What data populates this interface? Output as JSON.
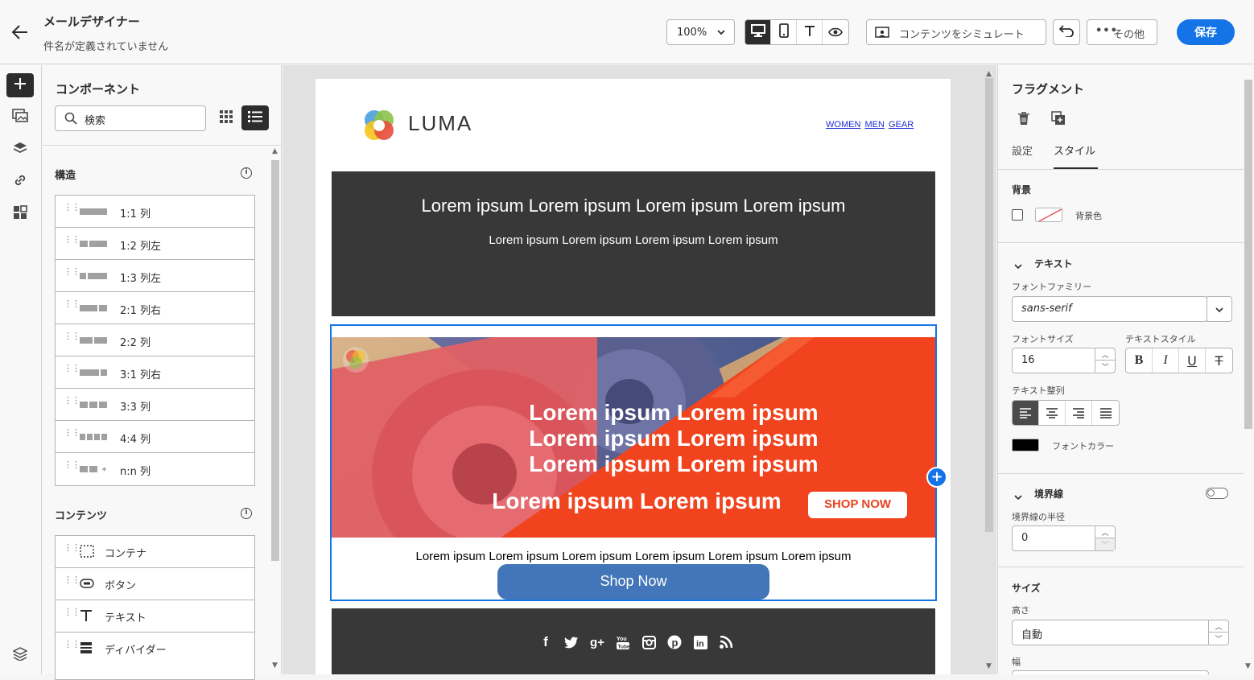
{
  "header": {
    "title": "メールデザイナー",
    "subtitle": "件名が定義されていません",
    "zoom": "100%",
    "simulate_label": "コンテンツをシミュレート",
    "more_label": "その他",
    "save_label": "保存"
  },
  "left_panel": {
    "title": "コンポーネント",
    "search_placeholder": "検索",
    "structure_title": "構造",
    "structure_items": [
      "1:1 列",
      "1:2 列左",
      "1:3 列左",
      "2:1 列右",
      "2:2 列",
      "3:1 列右",
      "3:3 列",
      "4:4 列",
      "n:n 列"
    ],
    "content_title": "コンテンツ",
    "content_items": [
      "コンテナ",
      "ボタン",
      "テキスト",
      "ディバイダー"
    ]
  },
  "email": {
    "brand": "LUMA",
    "nav": [
      "WOMEN",
      "MEN",
      "GEAR"
    ],
    "banner_heading": "Lorem ipsum Lorem ipsum  Lorem ipsum  Lorem ipsum",
    "banner_sub": "Lorem ipsum Lorem ipsum  Lorem ipsum  Lorem ipsum",
    "hero_lines": [
      "Lorem ipsum Lorem ipsum",
      "Lorem ipsum Lorem ipsum",
      "Lorem ipsum Lorem ipsum",
      "Lorem ipsum Lorem ipsum"
    ],
    "hero_button": "SHOP NOW",
    "body_text": "Lorem ipsum Lorem ipsum Lorem ipsum Lorem ipsum Lorem ipsum Lorem ipsum",
    "cta": "Shop Now",
    "social_icons": [
      "facebook-icon",
      "twitter-icon",
      "googleplus-icon",
      "youtube-icon",
      "instagram-icon",
      "pinterest-icon",
      "linkedin-icon",
      "rss-icon"
    ]
  },
  "right_panel": {
    "title": "フラグメント",
    "tab_settings": "設定",
    "tab_style": "スタイル",
    "bg_section": "背景",
    "bg_color_label": "背景色",
    "text_section": "テキスト",
    "font_family_label": "フォントファミリー",
    "font_family_value": "sans-serif",
    "font_size_label": "フォントサイズ",
    "font_size_value": "16",
    "text_style_label": "テキストスタイル",
    "text_align_label": "テキスト整列",
    "font_color_label": "フォントカラー",
    "border_section": "境界線",
    "border_radius_label": "境界線の半径",
    "border_radius_value": "0",
    "size_section": "サイズ",
    "height_label": "高さ",
    "height_value": "自動",
    "width_label": "幅"
  },
  "colors": {
    "accent": "#1473e6",
    "dark_block": "#383838",
    "hero_orange": "#f0431e",
    "cta_blue": "#4276b8"
  }
}
